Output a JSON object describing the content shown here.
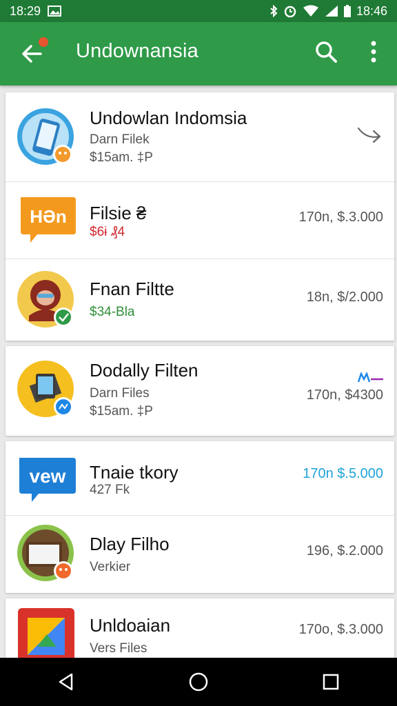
{
  "status_bar": {
    "time": "18:29",
    "right_time": "18:46",
    "icons": [
      "image-notification-icon",
      "bluetooth-icon",
      "alarm-icon",
      "wifi-icon",
      "signal-icon",
      "battery-icon"
    ]
  },
  "app_bar": {
    "title": "Undownansia",
    "back_icon": "arrow-back-icon",
    "search_icon": "search-icon",
    "more_icon": "more-vert-icon",
    "accent": "#2f9a48",
    "notification_dot_color": "#e7542d"
  },
  "items": [
    {
      "title": "Undowlan Indomsia",
      "line1": "Darn Filek",
      "line2": "$15am. ‡P",
      "price": "",
      "trailing_icon": "share-arrow-icon"
    },
    {
      "title": "Filsie ₴",
      "line1": "$6ɨ ₰4",
      "line2": "",
      "price": "170n, $.3.000",
      "thumb_text": "HƏn"
    },
    {
      "title": "Fnan Filtte",
      "line1": "$34-Bla",
      "line2": "",
      "price": "18n, $/2.000"
    },
    {
      "title": "Dodally Filten",
      "line1": "Darn Files",
      "line2": "$15am. ‡P",
      "price": "170n, $4300",
      "trailing_icon": "small-logo-icon"
    },
    {
      "title": "Tnaie tkory",
      "line1": "427 Fk",
      "line2": "",
      "price": "170n $.5.000",
      "thumb_text": "vew"
    },
    {
      "title": "Dlay Filho",
      "line1": "Verkier",
      "line2": "",
      "price": "196, $.2.000"
    },
    {
      "title": "Unldoaian",
      "line1": "Vers Files",
      "line2": "",
      "price": "170o, $.3.000"
    }
  ],
  "nav_bar": {
    "icons": [
      "nav-back-icon",
      "nav-home-icon",
      "nav-recents-icon"
    ]
  }
}
